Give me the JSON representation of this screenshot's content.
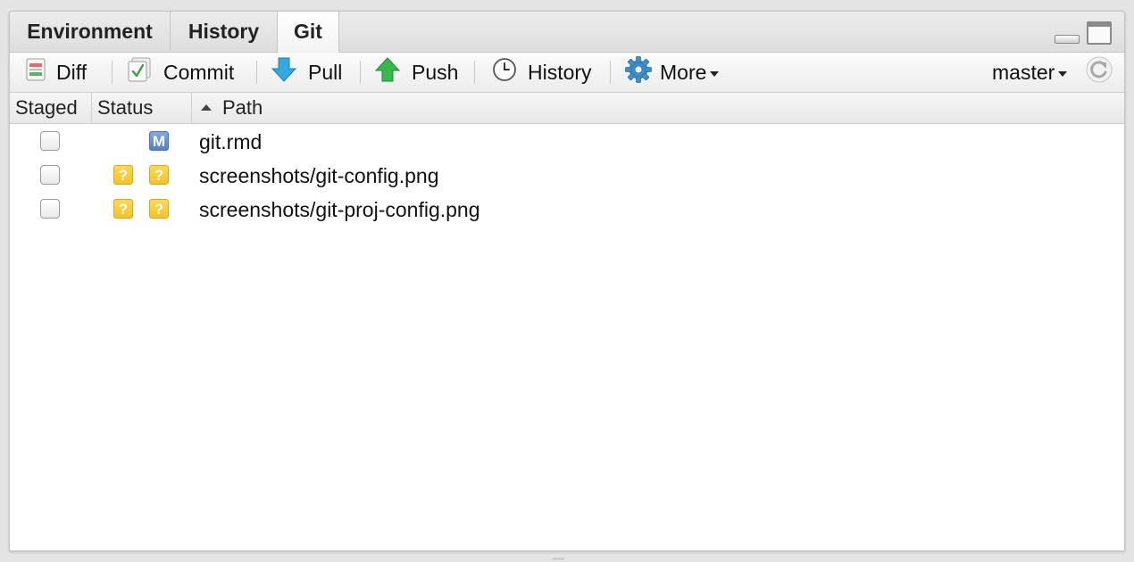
{
  "tabs": {
    "environment": "Environment",
    "history": "History",
    "git": "Git",
    "active": "Git"
  },
  "toolbar": {
    "diff": "Diff",
    "commit": "Commit",
    "pull": "Pull",
    "push": "Push",
    "history": "History",
    "more": "More",
    "branch": "master"
  },
  "columns": {
    "staged": "Staged",
    "status": "Status",
    "path": "Path"
  },
  "files": [
    {
      "staged": false,
      "index_status": "",
      "worktree_status": "M",
      "path": "git.rmd"
    },
    {
      "staged": false,
      "index_status": "?",
      "worktree_status": "?",
      "path": "screenshots/git-config.png"
    },
    {
      "staged": false,
      "index_status": "?",
      "worktree_status": "?",
      "path": "screenshots/git-proj-config.png"
    }
  ],
  "colors": {
    "modified_badge": "#5b8ad6",
    "untracked_badge": "#f5c934",
    "pull_arrow": "#2e9ed9",
    "push_arrow": "#2fb24a"
  }
}
